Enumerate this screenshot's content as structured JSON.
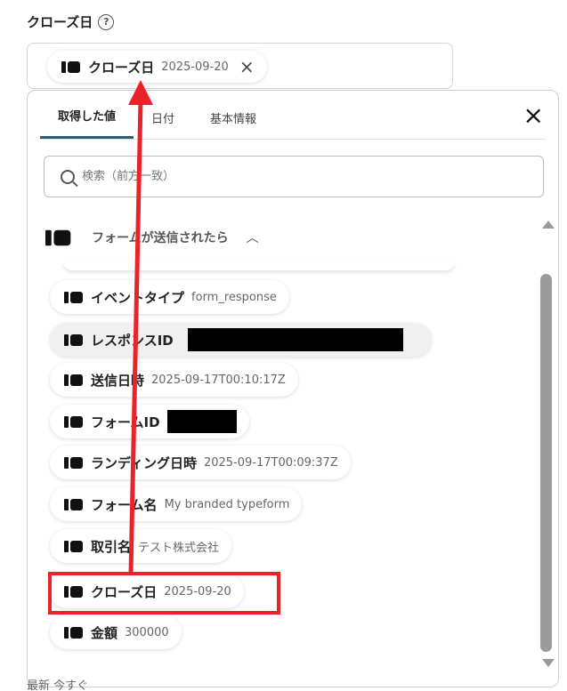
{
  "field": {
    "label": "クローズ日",
    "help_icon": "?"
  },
  "selected": {
    "name": "クローズ日",
    "value": "2025-09-20",
    "remove_icon": "×"
  },
  "panel": {
    "tabs": [
      "取得した値",
      "日付",
      "基本情報"
    ],
    "active_tab": "取得した値",
    "close_icon": "×",
    "search_placeholder": "検索（前方一致）",
    "group_title": "フォームが送信されたら",
    "group_chevron": "^"
  },
  "items": [
    {
      "name": "イベントタイプ",
      "value": "form_response"
    },
    {
      "name": "レスポンスID",
      "value": ""
    },
    {
      "name": "送信日時",
      "value": "2025-09-17T00:10:17Z"
    },
    {
      "name": "フォームID",
      "value": ""
    },
    {
      "name": "ランディング日時",
      "value": "2025-09-17T00:09:37Z"
    },
    {
      "name": "フォーム名",
      "value": "My branded typeform"
    },
    {
      "name": "取引名",
      "value": "テスト株式会社"
    },
    {
      "name": "クローズ日",
      "value": "2025-09-20"
    },
    {
      "name": "金額",
      "value": "300000"
    }
  ],
  "annotation": {
    "highlight_color": "#e8232a",
    "highlighted_item": "クローズ日"
  },
  "below_panel_text": "最新 今すぐ"
}
